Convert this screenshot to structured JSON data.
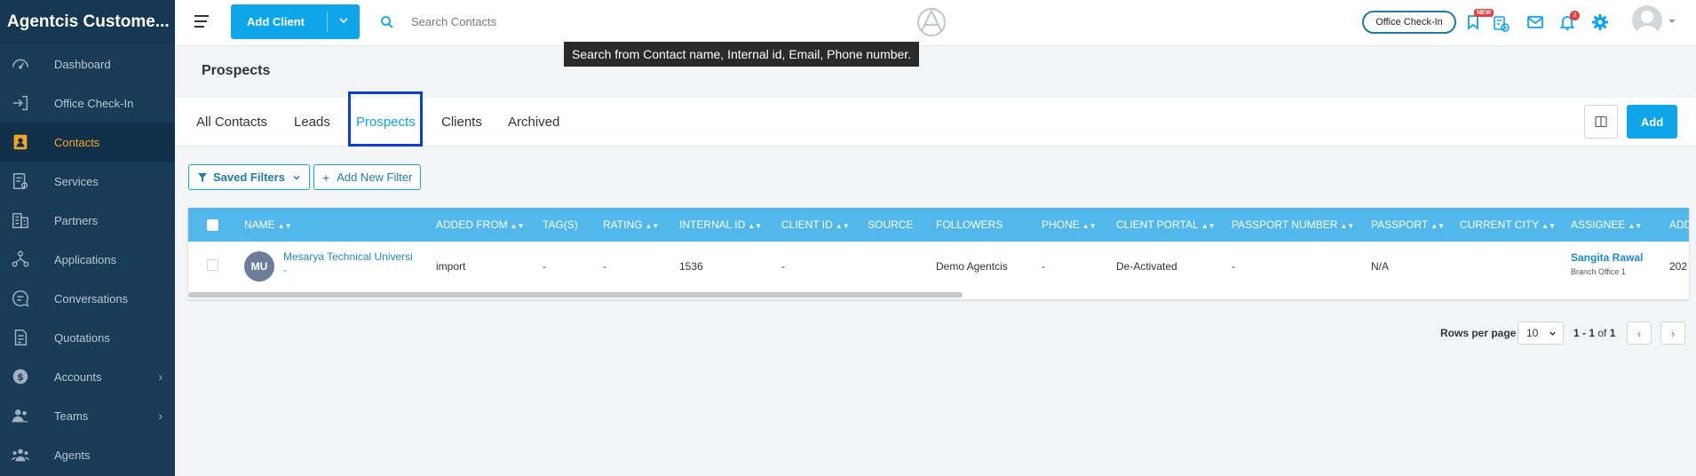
{
  "app": {
    "brand": "Agentcis Custome..."
  },
  "sidebar": {
    "items": [
      {
        "label": "Dashboard",
        "icon": "gauge-icon"
      },
      {
        "label": "Office Check-In",
        "icon": "checkin-icon"
      },
      {
        "label": "Contacts",
        "icon": "contact-card-icon",
        "active": true
      },
      {
        "label": "Services",
        "icon": "services-icon"
      },
      {
        "label": "Partners",
        "icon": "building-icon"
      },
      {
        "label": "Applications",
        "icon": "flow-icon"
      },
      {
        "label": "Conversations",
        "icon": "chat-icon"
      },
      {
        "label": "Quotations",
        "icon": "document-icon"
      },
      {
        "label": "Accounts",
        "icon": "dollar-icon",
        "has_submenu": true
      },
      {
        "label": "Teams",
        "icon": "team-icon",
        "has_submenu": true
      },
      {
        "label": "Agents",
        "icon": "agents-icon"
      }
    ]
  },
  "topbar": {
    "add_client_label": "Add Client",
    "search_placeholder": "Search Contacts",
    "checkin_label": "Office Check-In",
    "new_badge": "NEW",
    "notification_count": "3"
  },
  "tooltip": {
    "text": "Search from Contact name, Internal id, Email, Phone number."
  },
  "page": {
    "title": "Prospects"
  },
  "tabs": [
    {
      "label": "All Contacts"
    },
    {
      "label": "Leads"
    },
    {
      "label": "Prospects",
      "active": true
    },
    {
      "label": "Clients"
    },
    {
      "label": "Archived"
    }
  ],
  "actions": {
    "add_label": "Add"
  },
  "filters": {
    "saved_label": "Saved Filters",
    "new_label": "Add New Filter"
  },
  "table": {
    "columns": [
      "NAME",
      "ADDED FROM",
      "TAG(S)",
      "RATING",
      "INTERNAL ID",
      "CLIENT ID",
      "SOURCE",
      "FOLLOWERS",
      "PHONE",
      "CLIENT PORTAL",
      "PASSPORT NUMBER",
      "PASSPORT",
      "CURRENT CITY",
      "ASSIGNEE",
      "ADD"
    ],
    "rows": [
      {
        "initials": "MU",
        "name": "Mesarya Technical Universi",
        "name_suffix": "-",
        "added_from": "import",
        "tags": "-",
        "rating": "-",
        "internal_id": "1536",
        "client_id": "-",
        "source": "",
        "followers": "Demo Agentcis",
        "phone": "-",
        "client_portal": "De-Activated",
        "passport_number": "-",
        "passport": "N/A",
        "current_city": "",
        "assignee": "Sangita Rawal",
        "assignee_branch": "Branch Office 1",
        "added": "202"
      }
    ]
  },
  "pagination": {
    "rows_per_page_label": "Rows per page",
    "rows_per_page": "10",
    "range": "1 - 1",
    "of_label": "of",
    "total": "1"
  },
  "colors": {
    "sidebar": "#183b56",
    "accent": "#0ea5e9",
    "table_header": "#52b7ea",
    "active_nav": "#f5a623"
  }
}
